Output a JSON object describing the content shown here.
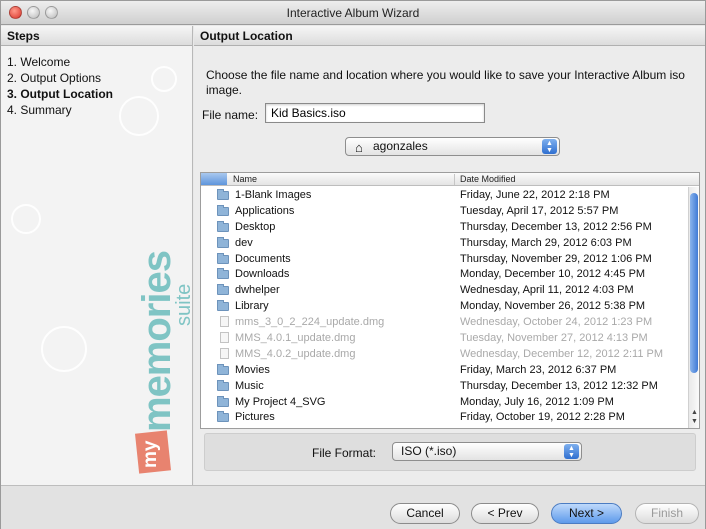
{
  "window": {
    "title": "Interactive Album Wizard"
  },
  "steps": {
    "header": "Steps",
    "items": [
      {
        "label": "1. Welcome",
        "active": false
      },
      {
        "label": "2. Output Options",
        "active": false
      },
      {
        "label": "3. Output Location",
        "active": true
      },
      {
        "label": "4. Summary",
        "active": false
      }
    ]
  },
  "brand": {
    "my": "my",
    "memories": "memories",
    "suite": "suite"
  },
  "main": {
    "header": "Output Location",
    "instructions": "Choose the file name and location where you would like to save your Interactive Album iso image.",
    "file_name_label": "File name:",
    "file_name_value": "Kid Basics.iso",
    "location": "agonzales",
    "columns": {
      "name": "Name",
      "date": "Date Modified"
    },
    "files": [
      {
        "name": "1-Blank Images",
        "date": "Friday, June 22, 2012 2:18 PM",
        "kind": "folder",
        "dim": false
      },
      {
        "name": "Applications",
        "date": "Tuesday, April 17, 2012 5:57 PM",
        "kind": "folder",
        "dim": false
      },
      {
        "name": "Desktop",
        "date": "Thursday, December 13, 2012 2:56 PM",
        "kind": "folder",
        "dim": false
      },
      {
        "name": "dev",
        "date": "Thursday, March 29, 2012 6:03 PM",
        "kind": "folder",
        "dim": false
      },
      {
        "name": "Documents",
        "date": "Thursday, November 29, 2012 1:06 PM",
        "kind": "folder",
        "dim": false
      },
      {
        "name": "Downloads",
        "date": "Monday, December 10, 2012 4:45 PM",
        "kind": "folder",
        "dim": false
      },
      {
        "name": "dwhelper",
        "date": "Wednesday, April 11, 2012 4:03 PM",
        "kind": "folder",
        "dim": false
      },
      {
        "name": "Library",
        "date": "Monday, November 26, 2012 5:38 PM",
        "kind": "folder",
        "dim": false
      },
      {
        "name": "mms_3_0_2_224_update.dmg",
        "date": "Wednesday, October 24, 2012 1:23 PM",
        "kind": "file",
        "dim": true
      },
      {
        "name": "MMS_4.0.1_update.dmg",
        "date": "Tuesday, November 27, 2012 4:13 PM",
        "kind": "file",
        "dim": true
      },
      {
        "name": "MMS_4.0.2_update.dmg",
        "date": "Wednesday, December 12, 2012 2:11 PM",
        "kind": "file",
        "dim": true
      },
      {
        "name": "Movies",
        "date": "Friday, March 23, 2012 6:37 PM",
        "kind": "folder",
        "dim": false
      },
      {
        "name": "Music",
        "date": "Thursday, December 13, 2012 12:32 PM",
        "kind": "folder",
        "dim": false
      },
      {
        "name": "My Project 4_SVG",
        "date": "Monday, July 16, 2012 1:09 PM",
        "kind": "folder",
        "dim": false
      },
      {
        "name": "Pictures",
        "date": "Friday, October 19, 2012 2:28 PM",
        "kind": "folder",
        "dim": false
      }
    ],
    "file_format_label": "File Format:",
    "file_format_value": "ISO (*.iso)"
  },
  "buttons": {
    "cancel": "Cancel",
    "prev": "< Prev",
    "next": "Next >",
    "finish": "Finish"
  },
  "colors": {
    "accent_blue": "#5d9aeb",
    "brand_teal": "#7fc4c4",
    "brand_coral": "#e8836f"
  }
}
